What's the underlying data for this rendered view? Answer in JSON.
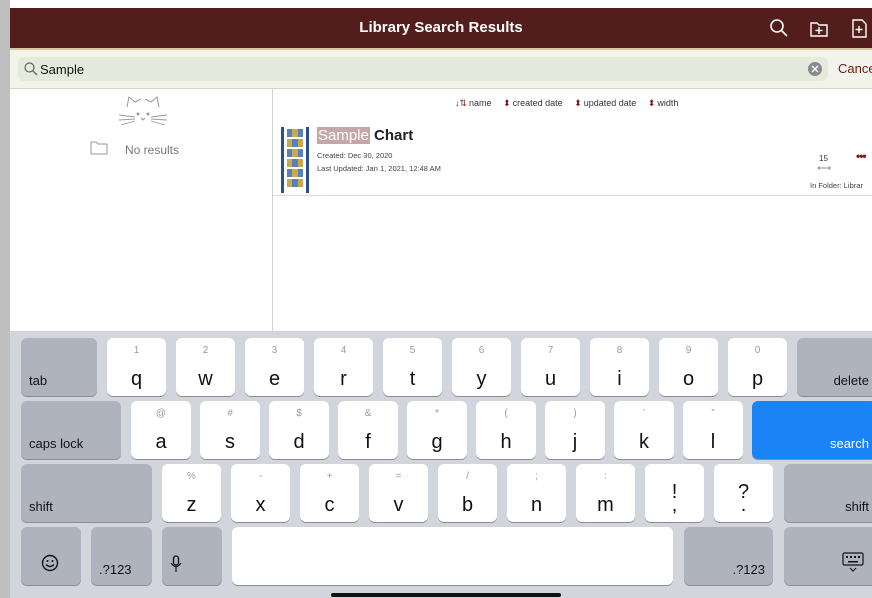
{
  "header": {
    "title": "Library Search Results",
    "icons": [
      "search-icon",
      "add-folder-icon",
      "add-file-icon"
    ],
    "background": "#531d1c"
  },
  "search": {
    "value": "Sample",
    "cancel_label": "Cance"
  },
  "left_pane": {
    "empty_label": "No results"
  },
  "sort": {
    "options": [
      "name",
      "created date",
      "updated date",
      "width"
    ]
  },
  "results": [
    {
      "name_highlight": "Sample",
      "name_rest": " Chart",
      "created": "Created: Dec 30, 2020",
      "updated": "Last Updated: Jan 1, 2021, 12:48 AM",
      "width": "15",
      "folder": "In Folder: Librar",
      "more": "•••"
    }
  ],
  "keyboard": {
    "row1": [
      {
        "sub": "1",
        "main": "q"
      },
      {
        "sub": "2",
        "main": "w"
      },
      {
        "sub": "3",
        "main": "e"
      },
      {
        "sub": "4",
        "main": "r"
      },
      {
        "sub": "5",
        "main": "t"
      },
      {
        "sub": "6",
        "main": "y"
      },
      {
        "sub": "7",
        "main": "u"
      },
      {
        "sub": "8",
        "main": "i"
      },
      {
        "sub": "9",
        "main": "o"
      },
      {
        "sub": "0",
        "main": "p"
      }
    ],
    "row2": [
      {
        "sub": "@",
        "main": "a"
      },
      {
        "sub": "#",
        "main": "s"
      },
      {
        "sub": "$",
        "main": "d"
      },
      {
        "sub": "&",
        "main": "f"
      },
      {
        "sub": "*",
        "main": "g"
      },
      {
        "sub": "(",
        "main": "h"
      },
      {
        "sub": ")",
        "main": "j"
      },
      {
        "sub": "’",
        "main": "k"
      },
      {
        "sub": "”",
        "main": "l"
      }
    ],
    "row3": [
      {
        "sub": "%",
        "main": "z"
      },
      {
        "sub": "-",
        "main": "x"
      },
      {
        "sub": "+",
        "main": "c"
      },
      {
        "sub": "=",
        "main": "v"
      },
      {
        "sub": "/",
        "main": "b"
      },
      {
        "sub": ";",
        "main": "n"
      },
      {
        "sub": ":",
        "main": "m"
      },
      {
        "sub": "",
        "main": "!\n,"
      },
      {
        "sub": "",
        "main": "?\n."
      }
    ],
    "tab": "tab",
    "delete": "delete",
    "caps": "caps lock",
    "search": "search",
    "shift": "shift",
    "numbers": ".?123",
    "accent": "#1a84f7"
  }
}
